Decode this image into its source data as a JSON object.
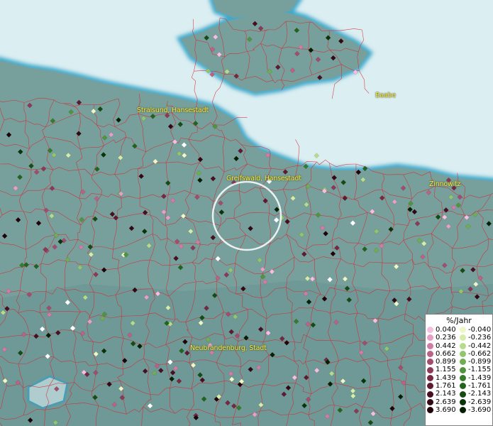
{
  "map": {
    "colors": {
      "sea": "#dbeef2",
      "land": "#77a09d",
      "land_dark": "#5e8d8c",
      "coast": "#3fa7c8",
      "borders": "#d7262e",
      "label": "#ffe94a"
    },
    "cities": [
      {
        "id": "stralsund",
        "name": "Stralsund, Hansestadt"
      },
      {
        "id": "greifswald",
        "name": "Greifswald, Hansestadt"
      },
      {
        "id": "baabe",
        "name": "Baabe"
      },
      {
        "id": "zinnowitz",
        "name": "Zinnowitz"
      },
      {
        "id": "neubrandenburg",
        "name": "Neubrandenburg, Stadt"
      }
    ]
  },
  "legend": {
    "title": "%/Jahr",
    "positive": [
      {
        "label": "0.040",
        "color": "#f6bfe2"
      },
      {
        "label": "0.236",
        "color": "#e79fc6"
      },
      {
        "label": "0.442",
        "color": "#d07ca5"
      },
      {
        "label": "0.662",
        "color": "#bb6286"
      },
      {
        "label": "0.899",
        "color": "#a44c6d"
      },
      {
        "label": "1.155",
        "color": "#8c3958"
      },
      {
        "label": "1.439",
        "color": "#762843"
      },
      {
        "label": "1.761",
        "color": "#5f1a31"
      },
      {
        "label": "2.143",
        "color": "#490f21"
      },
      {
        "label": "2.639",
        "color": "#340714"
      },
      {
        "label": "3.690",
        "color": "#200208"
      }
    ],
    "negative": [
      {
        "label": "-0.040",
        "color": "#f0f7c6"
      },
      {
        "label": "-0.236",
        "color": "#d6edaa"
      },
      {
        "label": "-0.442",
        "color": "#b6dc8a"
      },
      {
        "label": "-0.662",
        "color": "#92c66c"
      },
      {
        "label": "-0.899",
        "color": "#6fae52"
      },
      {
        "label": "-1.155",
        "color": "#50953c"
      },
      {
        "label": "-1.439",
        "color": "#377c2a"
      },
      {
        "label": "-1.761",
        "color": "#23641c"
      },
      {
        "label": "-2.143",
        "color": "#144c11"
      },
      {
        "label": "-2.639",
        "color": "#093508"
      },
      {
        "label": "-3.690",
        "color": "#032002"
      }
    ]
  }
}
